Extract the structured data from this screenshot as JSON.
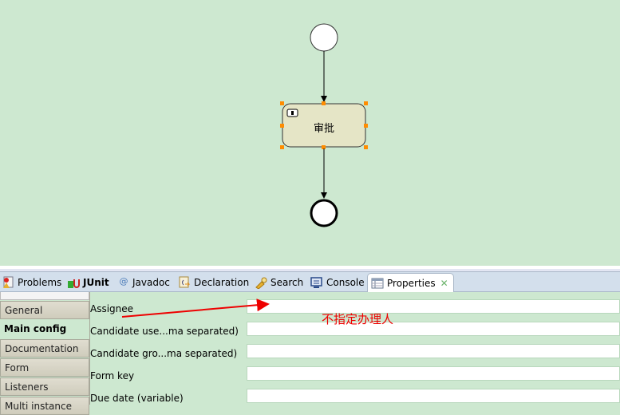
{
  "diagram": {
    "task_label": "审批",
    "start_event": "start-event",
    "end_event": "end-event"
  },
  "tabs": [
    {
      "label": "Problems",
      "icon": "problems-icon",
      "bold": false,
      "active": false
    },
    {
      "label": "JUnit",
      "icon": "junit-icon",
      "bold": true,
      "active": false
    },
    {
      "label": "Javadoc",
      "icon": "javadoc-at-icon",
      "bold": false,
      "active": false
    },
    {
      "label": "Declaration",
      "icon": "declaration-icon",
      "bold": false,
      "active": false
    },
    {
      "label": "Search",
      "icon": "search-flashlight-icon",
      "bold": false,
      "active": false
    },
    {
      "label": "Console",
      "icon": "console-icon",
      "bold": false,
      "active": false
    },
    {
      "label": "Properties",
      "icon": "properties-icon",
      "bold": false,
      "active": true
    }
  ],
  "properties": {
    "side_tabs": [
      {
        "label": "General",
        "selected": false
      },
      {
        "label": "Main config",
        "selected": true
      },
      {
        "label": "Documentation",
        "selected": false
      },
      {
        "label": "Form",
        "selected": false
      },
      {
        "label": "Listeners",
        "selected": false
      },
      {
        "label": "Multi instance",
        "selected": false
      }
    ],
    "fields": [
      {
        "label": "Assignee",
        "value": ""
      },
      {
        "label": "Candidate use...ma separated)",
        "value": ""
      },
      {
        "label": "Candidate gro...ma separated)",
        "value": ""
      },
      {
        "label": "Form key",
        "value": ""
      },
      {
        "label": "Due date (variable)",
        "value": ""
      }
    ]
  },
  "annotation": {
    "text": "不指定办理人",
    "color": "#ee0000"
  },
  "colors": {
    "canvas_bg": "#cde8d0",
    "task_fill": "#e5e5c6",
    "handle": "#ff8c00"
  }
}
